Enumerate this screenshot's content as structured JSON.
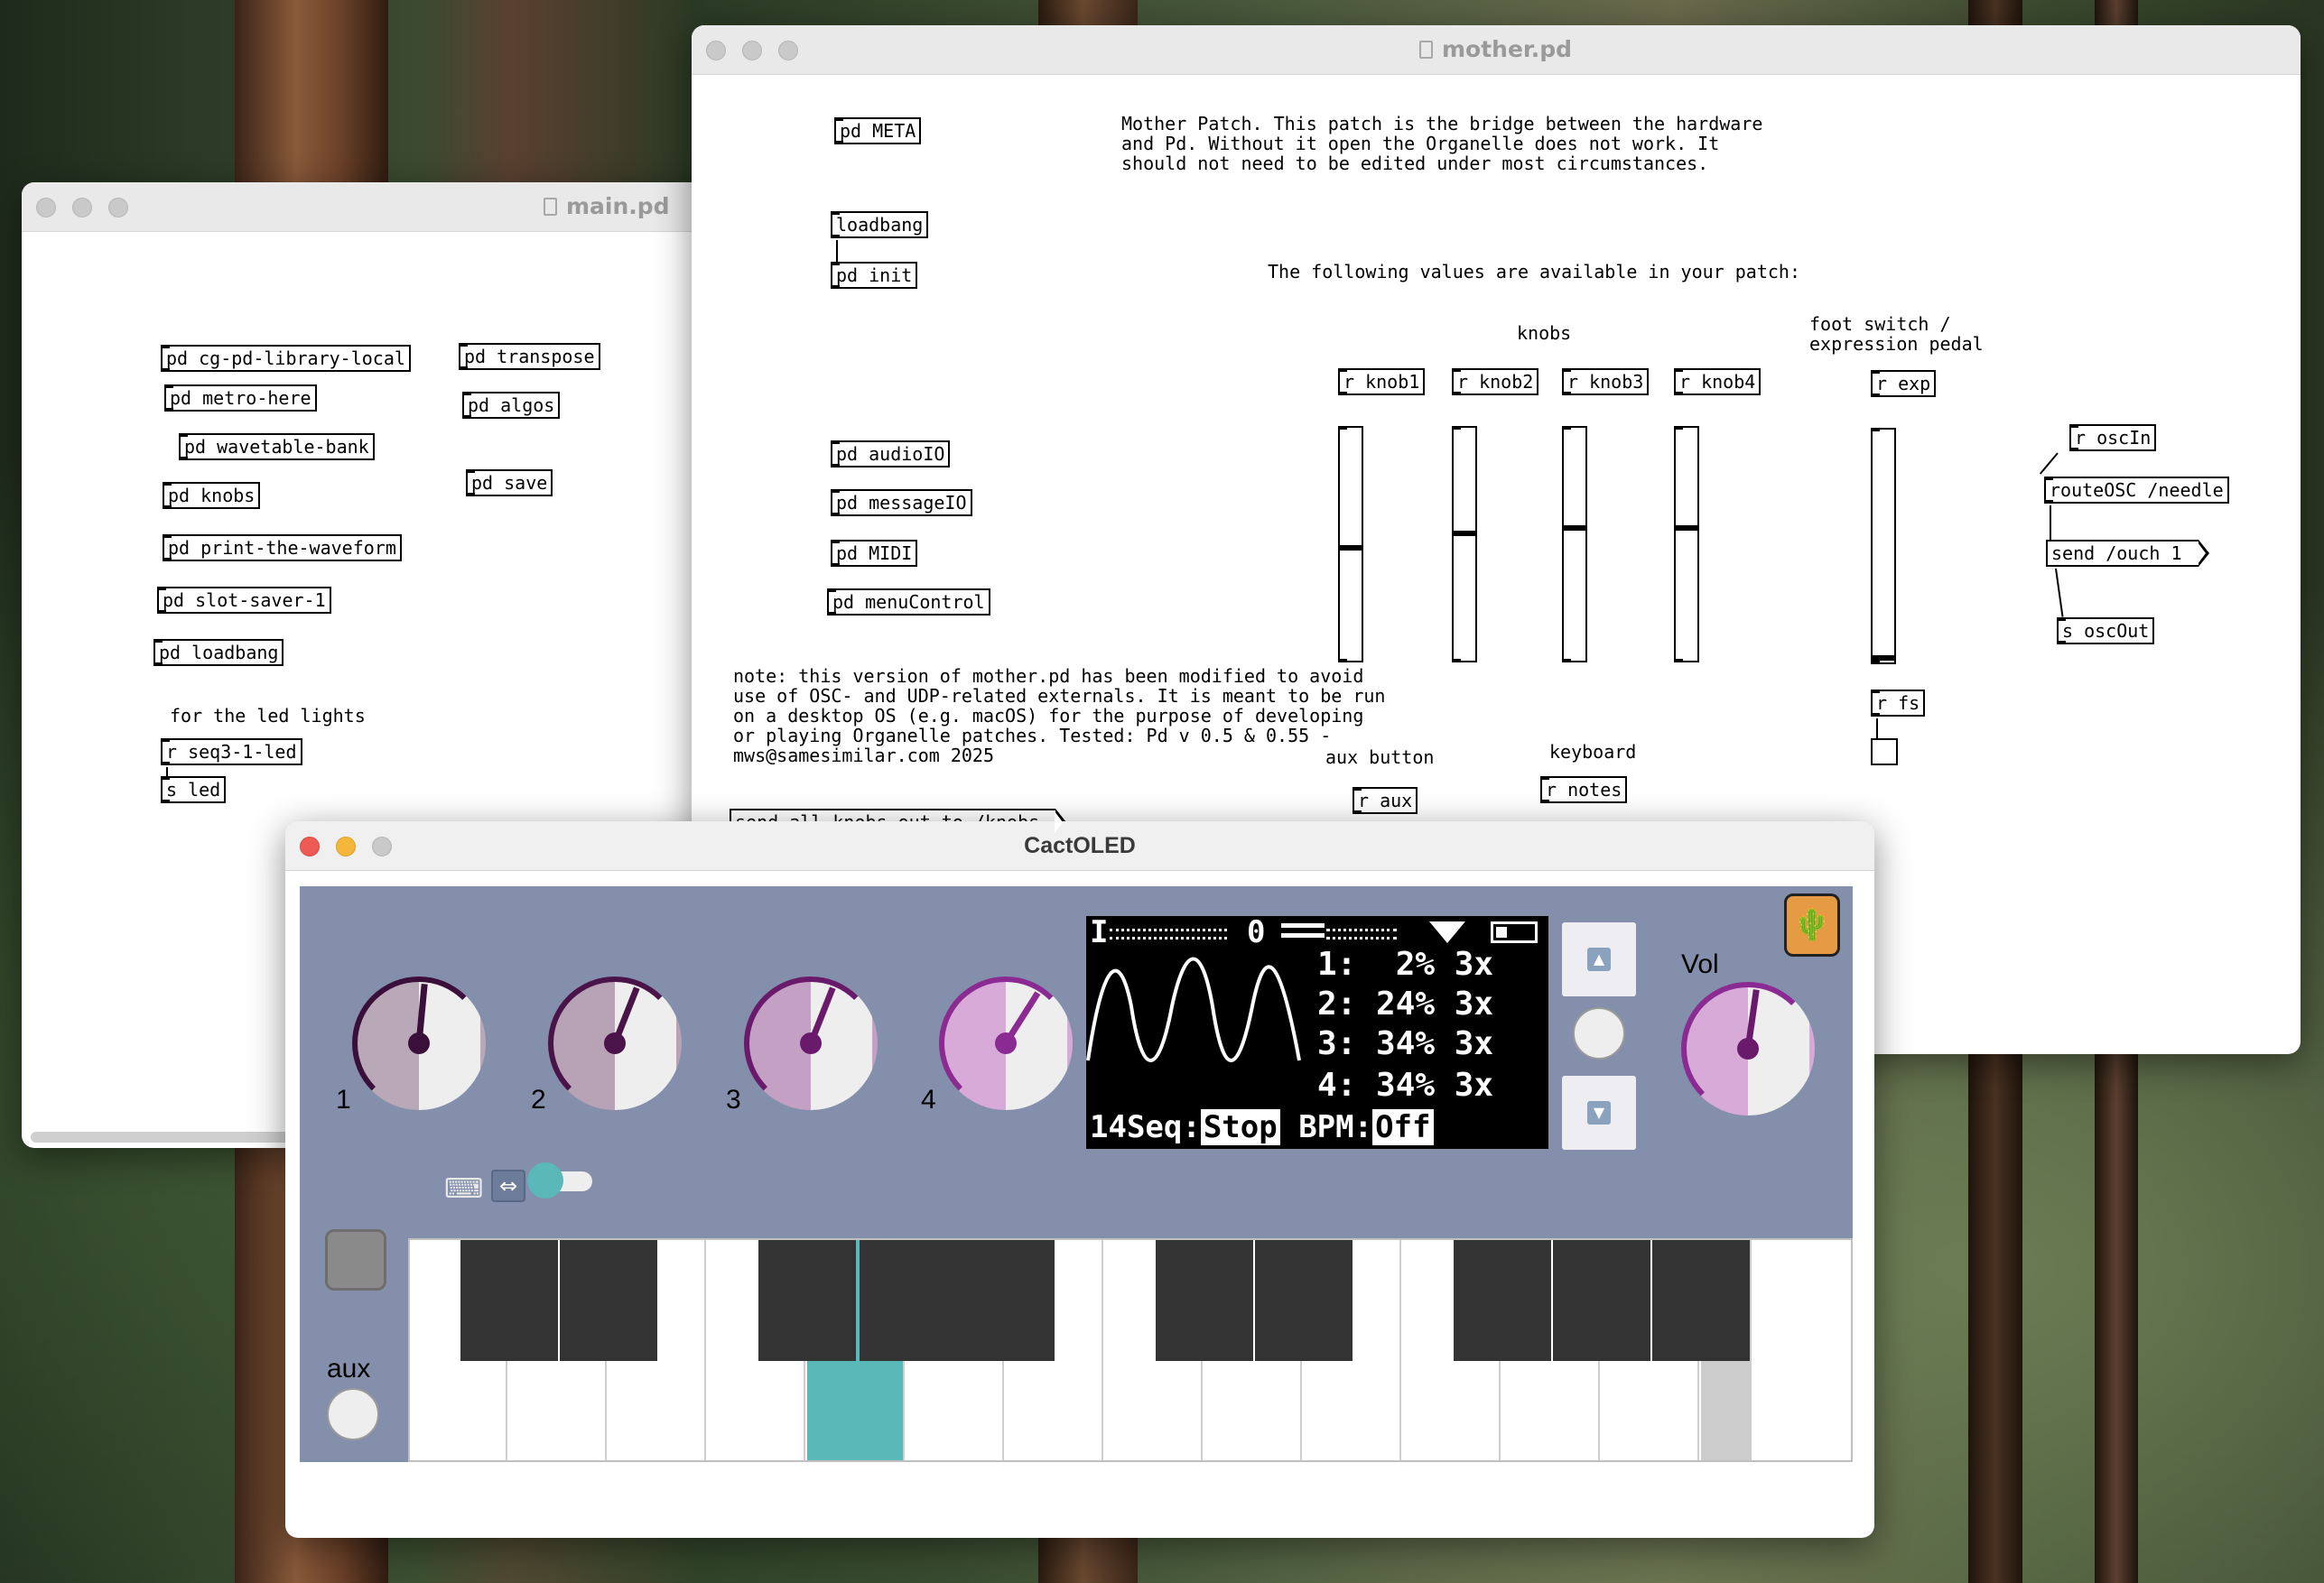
{
  "desktop": {
    "accent": "#5bb8b8"
  },
  "main_window": {
    "title": "main.pd",
    "objects": [
      "pd cg-pd-library-local",
      "pd metro-here",
      "pd wavetable-bank",
      "pd knobs",
      "pd print-the-waveform",
      "pd slot-saver-1",
      "pd loadbang",
      "pd transpose",
      "pd algos",
      "pd save",
      "r seq3-1-led",
      "s led"
    ],
    "comment_led": "for the led lights"
  },
  "mother_window": {
    "title": "mother.pd",
    "objects": [
      "pd META",
      "loadbang",
      "pd init",
      "pd audioIO",
      "pd messageIO",
      "pd MIDI",
      "pd menuControl",
      "r knob1",
      "r knob2",
      "r knob3",
      "r knob4",
      "r exp",
      "r fs",
      "r aux",
      "r notes",
      "r oscIn",
      "routeOSC /needle",
      "s oscOut"
    ],
    "message_send_ouch": "send /ouch 1",
    "message_send_knobs": "send all knobs out to /knobs",
    "comment_intro": "Mother Patch. This patch is the bridge between the hardware\nand Pd. Without it open the Organelle does not work. It\nshould not need to be edited under most circumstances.",
    "comment_values": "The following values are available in your patch:",
    "comment_knobs": "knobs",
    "comment_foot": "foot switch /\nexpression pedal",
    "comment_aux": "aux button",
    "comment_keyboard": "keyboard",
    "comment_note": "note: this version of mother.pd has been modified to avoid\nuse of OSC- and UDP-related externals. It is meant to be run\non a desktop OS (e.g. macOS) for the purpose of developing\nor playing Organelle patches. Tested: Pd v 0.5 & 0.55 -\nmws@samesimilar.com 2025"
  },
  "cactoled": {
    "title": "CactOLED",
    "knobs": [
      {
        "label": "1",
        "value": 0.52,
        "color": "#3a0f3a",
        "fill": "#b8a8b8"
      },
      {
        "label": "2",
        "value": 0.58,
        "color": "#4a1448",
        "fill": "#b8a2b6"
      },
      {
        "label": "3",
        "value": 0.58,
        "color": "#6a1a6a",
        "fill": "#c4a0c4"
      },
      {
        "label": "4",
        "value": 0.62,
        "color": "#8a2a92",
        "fill": "#d8aad8"
      }
    ],
    "vol_label": "Vol",
    "vol_value": 0.53,
    "aux_label": "aux",
    "oled": {
      "status_left": "I",
      "status_mid": "0",
      "lines": [
        "1:  2% 3x",
        "2: 24% 3x",
        "3: 34% 3x",
        "4: 34% 3x"
      ],
      "bottom_prefix": "14Seq:",
      "bottom_stop": "Stop",
      "bottom_bpm": " BPM:",
      "bottom_off": "Off"
    },
    "up_arrow": "▲",
    "down_arrow": "▼",
    "keyboard_icon": "⌨",
    "toggle_icon": "⇔",
    "cactus_icon": "🌵"
  }
}
